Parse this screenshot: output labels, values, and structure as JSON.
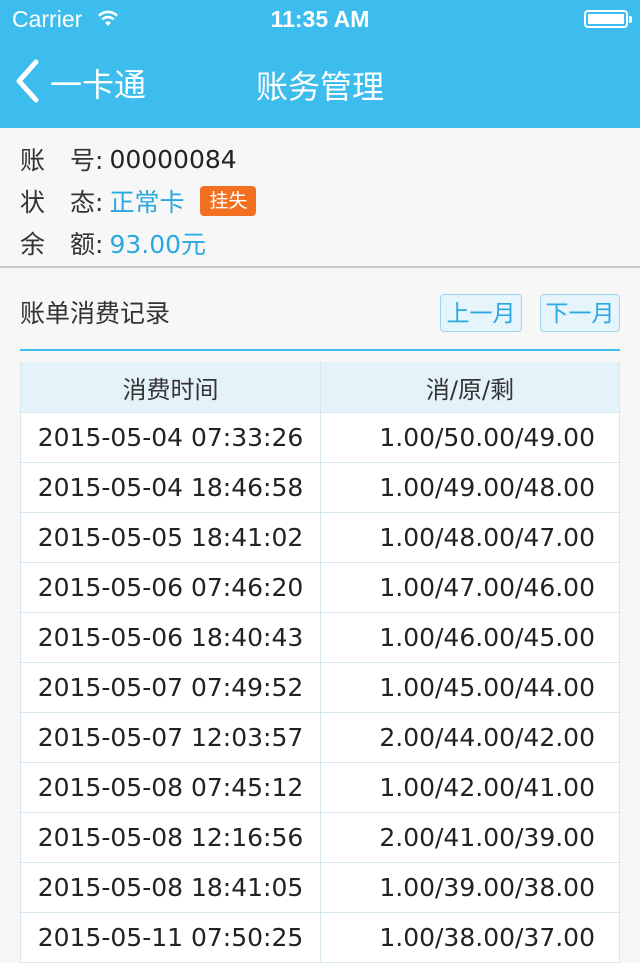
{
  "status_bar": {
    "carrier": "Carrier",
    "time": "11:35 AM"
  },
  "nav": {
    "back_label": "一卡通",
    "title": "账务管理"
  },
  "account": {
    "number_label": "账　号:",
    "number_value": "00000084",
    "state_label": "状　态:",
    "state_value": "正常卡",
    "report_loss_label": "挂失",
    "balance_label": "余　额:",
    "balance_value": "93.00元"
  },
  "records": {
    "title": "账单消费记录",
    "prev_month_label": "上一月",
    "next_month_label": "下一月",
    "columns": [
      "消费时间",
      "消/原/剩"
    ],
    "rows": [
      [
        "2015-05-04 07:33:26",
        "1.00/50.00/49.00"
      ],
      [
        "2015-05-04 18:46:58",
        "1.00/49.00/48.00"
      ],
      [
        "2015-05-05 18:41:02",
        "1.00/48.00/47.00"
      ],
      [
        "2015-05-06 07:46:20",
        "1.00/47.00/46.00"
      ],
      [
        "2015-05-06 18:40:43",
        "1.00/46.00/45.00"
      ],
      [
        "2015-05-07 07:49:52",
        "1.00/45.00/44.00"
      ],
      [
        "2015-05-07 12:03:57",
        "2.00/44.00/42.00"
      ],
      [
        "2015-05-08 07:45:12",
        "1.00/42.00/41.00"
      ],
      [
        "2015-05-08 12:16:56",
        "2.00/41.00/39.00"
      ],
      [
        "2015-05-08 18:41:05",
        "1.00/39.00/38.00"
      ],
      [
        "2015-05-11 07:50:25",
        "1.00/38.00/37.00"
      ]
    ]
  },
  "colors": {
    "accent": "#3dbdee",
    "link": "#2aa8e0",
    "badge": "#f37021"
  }
}
